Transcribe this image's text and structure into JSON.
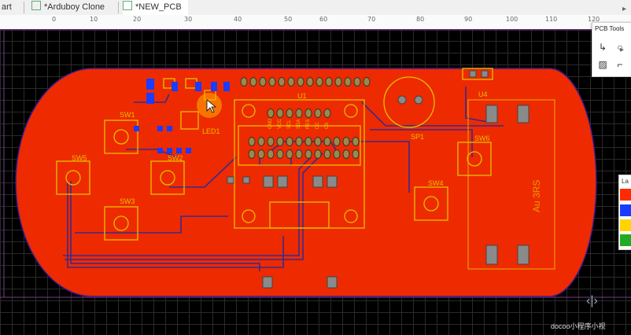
{
  "tabs": [
    {
      "label": "art"
    },
    {
      "label": "*Arduboy Clone"
    },
    {
      "label": "*NEW_PCB"
    }
  ],
  "ruler": {
    "ticks": [
      "0",
      "10",
      "20",
      "30",
      "40",
      "50",
      "60",
      "70",
      "80",
      "90",
      "100",
      "110",
      "120"
    ]
  },
  "pcb_tools": {
    "title": "PCB Tools",
    "tools": [
      "route-track-icon",
      "via-icon",
      "image-icon",
      "dimension-icon"
    ]
  },
  "layers": {
    "title": "La",
    "colors": [
      "#ff2a00",
      "#1a3cff",
      "#ffd400",
      "#22aa22"
    ]
  },
  "board": {
    "copper_color": "#ee2a00",
    "silkscreen_color": "#e6c100",
    "trace_color": "#3a2a8a",
    "labels": {
      "u1": "U1",
      "led1": "LED1",
      "sw1": "SW1",
      "sw2": "SW2",
      "sw3": "SW3",
      "sw4": "SW4",
      "sw5": "SW5",
      "sw6": "SW6",
      "sp1": "SP1",
      "u4": "U4",
      "pin_gnd": "GND",
      "pin_vcc": "VCC",
      "pin_scl": "SCL",
      "pin_sda": "SDA",
      "pin_res": "RES",
      "pin_dc": "DC",
      "pin_cs": "CS",
      "battery": "Au 3RS"
    }
  },
  "watermark": "docoo小程序小视"
}
